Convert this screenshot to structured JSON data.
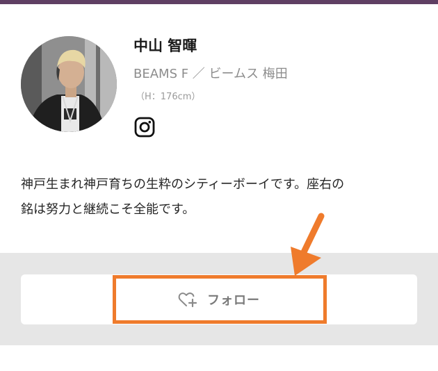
{
  "header": {
    "accent_color": "#5f3f63"
  },
  "profile": {
    "name": "中山 智暉",
    "shop": "BEAMS F ／ ビームス 梅田",
    "height": "（H：176cm）",
    "avatar_icon": "staff-photo",
    "social": {
      "icon": "instagram-icon"
    }
  },
  "bio": {
    "line1": "神戸生まれ神戸育ちの生粋のシティーボーイです。座右の",
    "line2": "銘は努力と継続こそ全能です。"
  },
  "follow": {
    "label": "フォロー",
    "icon": "heart-plus-icon"
  },
  "annotation": {
    "color": "#ef7b2c"
  }
}
